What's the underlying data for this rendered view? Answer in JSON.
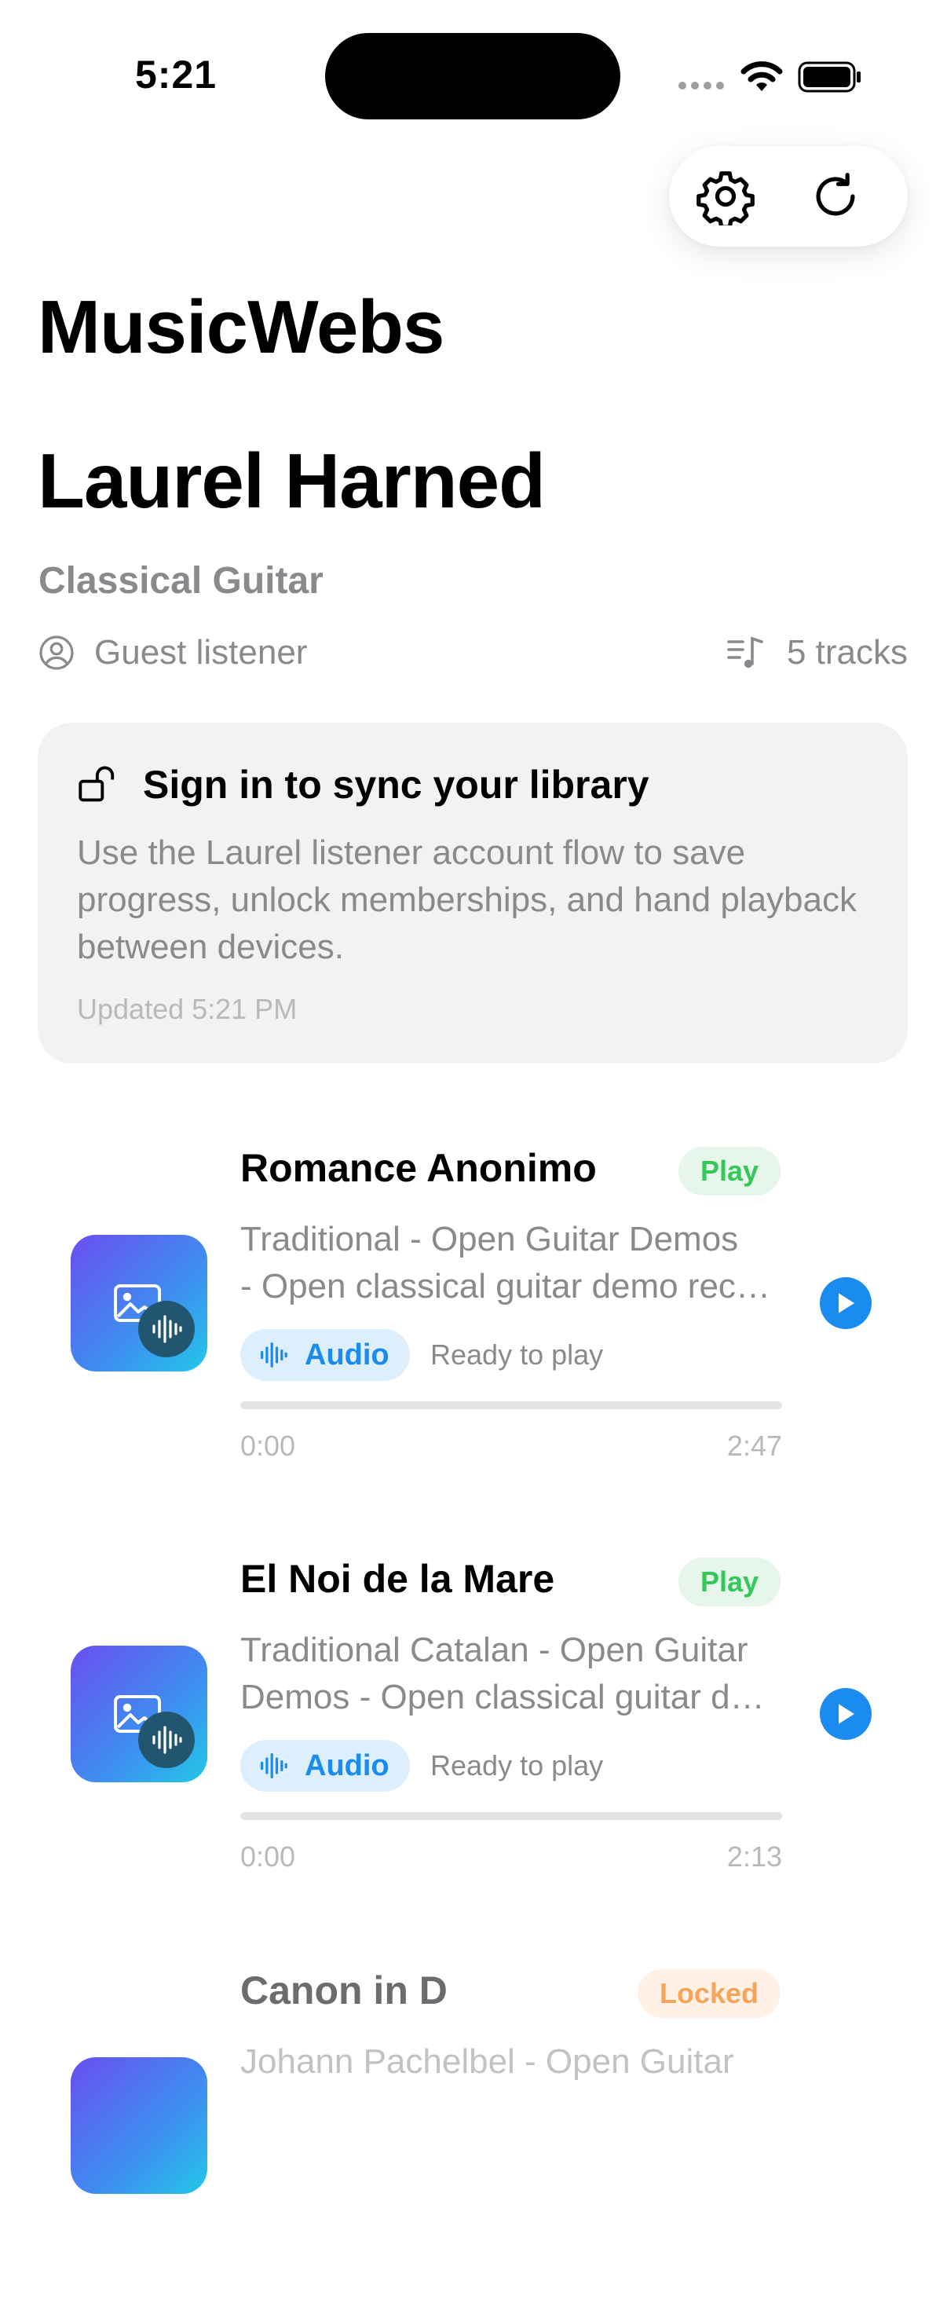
{
  "status_bar": {
    "time": "5:21"
  },
  "app": {
    "title": "MusicWebs"
  },
  "artist": {
    "name": "Laurel Harned",
    "genre": "Classical Guitar",
    "listener_label": "Guest listener",
    "track_count_label": "5 tracks"
  },
  "toolbar": {
    "settings_icon": "gear-icon",
    "refresh_icon": "refresh-icon"
  },
  "signin_card": {
    "title": "Sign in to sync your library",
    "body": "Use the Laurel listener account flow to save progress, unlock memberships, and hand playback between devices.",
    "updated": "Updated 5:21 PM"
  },
  "tracks": [
    {
      "title": "Romance Anonimo",
      "badge": "Play",
      "description_line1": "Traditional - Open Guitar Demos",
      "description_line2": "- Open classical guitar demo recording",
      "audio_label": "Audio",
      "status": "Ready to play",
      "progress": 0,
      "time_start": "0:00",
      "time_end": "2:47"
    },
    {
      "title": "El Noi de la Mare",
      "badge": "Play",
      "description_line1": "Traditional Catalan - Open Guitar",
      "description_line2": "Demos - Open classical guitar demo recording",
      "audio_label": "Audio",
      "status": "Ready to play",
      "progress": 0,
      "time_start": "0:00",
      "time_end": "2:13"
    },
    {
      "title": "Canon in D",
      "badge": "Locked",
      "description_line1": "Johann Pachelbel - Open Guitar"
    }
  ],
  "colors": {
    "accent": "#1a8cf0",
    "play_badge": "#34c759",
    "locked_badge": "#f5a45a"
  }
}
